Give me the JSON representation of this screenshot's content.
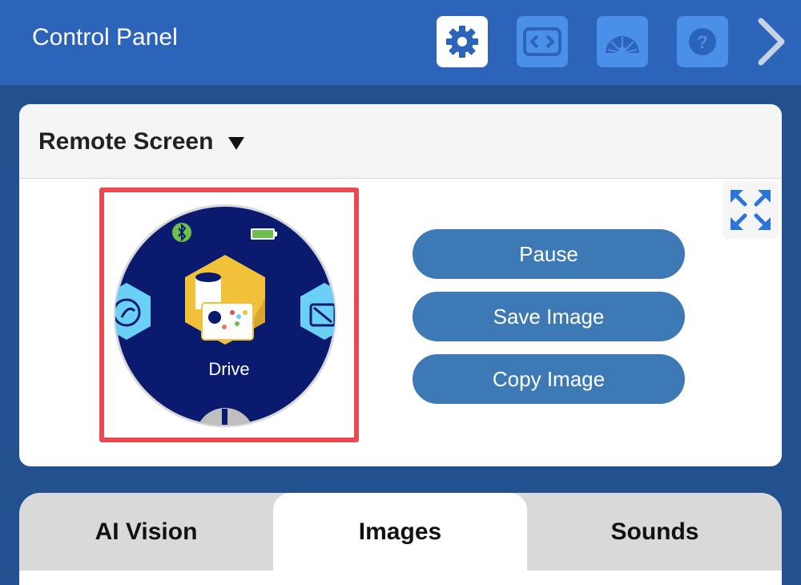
{
  "header": {
    "title": "Control Panel",
    "buttons": [
      {
        "icon": "gear-icon",
        "active": true
      },
      {
        "icon": "code-icon",
        "active": false
      },
      {
        "icon": "dashboard-gauge-icon",
        "active": false
      },
      {
        "icon": "help-icon",
        "active": false
      }
    ],
    "next_icon": "chevron-right-icon"
  },
  "remote_screen": {
    "title": "Remote Screen",
    "dropdown_icon": "triangle-down-icon",
    "expand_icon": "expand-arrows-icon",
    "screen": {
      "center_app_label": "Drive",
      "status_icons": [
        "bluetooth-icon",
        "battery-icon"
      ],
      "bottom_icon": "info-icon",
      "highlight_color": "#e84a50",
      "background_color": "#0a1a6e"
    },
    "buttons": {
      "pause": "Pause",
      "save_image": "Save Image",
      "copy_image": "Copy Image"
    }
  },
  "tabs": {
    "items": [
      {
        "label": "AI Vision",
        "active": false
      },
      {
        "label": "Images",
        "active": true
      },
      {
        "label": "Sounds",
        "active": false
      }
    ]
  },
  "colors": {
    "background": "#23508f",
    "header": "#2b64b9",
    "header_button": "#4a8fe8",
    "action_button": "#3d79b4",
    "tab_inactive": "#d9d9d9"
  }
}
